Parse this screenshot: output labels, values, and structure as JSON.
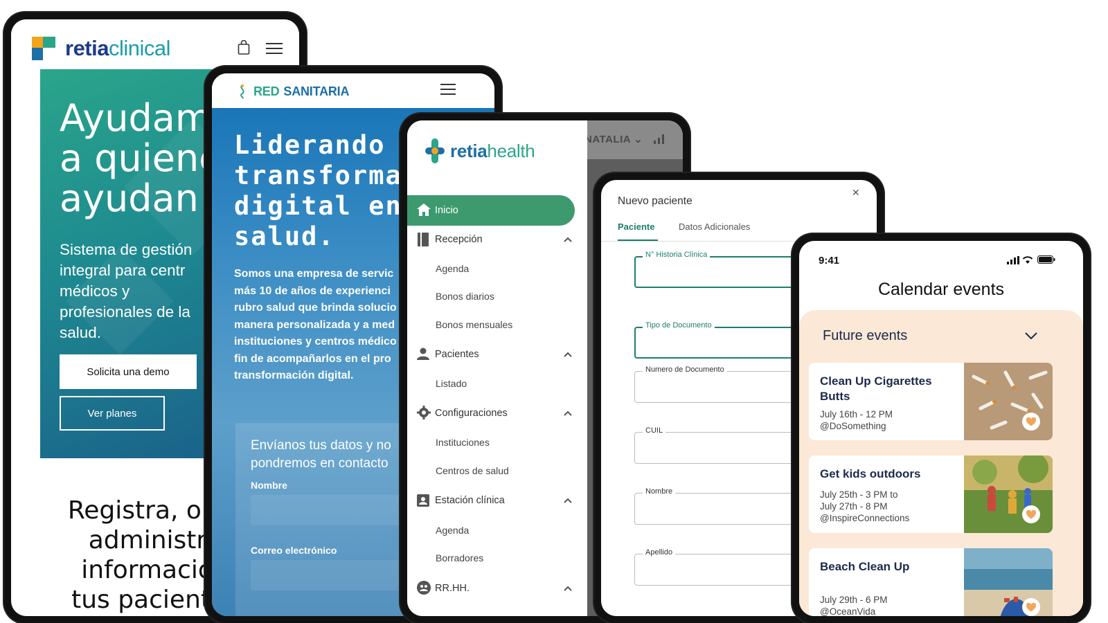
{
  "phone1": {
    "brand_bold": "retia",
    "brand_light": "clinical",
    "hero_title": "Ayudam\na quiene\nayudan",
    "hero_subtitle": "Sistema de gestión\nintegral para centr\nmédicos y\nprofesionales de la\nsalud.",
    "demo_button": "Solicita una demo",
    "plans_button": "Ver planes",
    "bottom_text": "Registra, orde\nadministra\ninformación\ntus pacientes",
    "colors": {
      "hero_start": "#2aa58a",
      "hero_end": "#1a5f8a",
      "brand_dark": "#1d3a8a",
      "brand_light": "#1d9bb0"
    }
  },
  "phone2": {
    "brand_red": "RED",
    "brand_sanitaria": "SANITARIA",
    "hero_title": "Liderando la\ntransformac\ndigital en\nsalud.",
    "hero_paragraph": "Somos una empresa de servic\nmás 10 de años de experienci\nrubro salud que brinda solucio\nmanera personalizada y a med\ninstituciones y centros médico\nfin de acompañarlos en el pro\ntransformación digital.",
    "form_title": "Envíanos tus datos y no\npondremos en contacto",
    "label_name": "Nombre",
    "label_email": "Correo electrónico"
  },
  "phone3": {
    "brand_a": "retia",
    "brand_b": "health",
    "user": "NATALIA",
    "menu": [
      {
        "label": "Inicio",
        "icon": "home-icon",
        "active": true
      },
      {
        "label": "Recepción",
        "icon": "book-icon"
      },
      {
        "label": "Pacientes",
        "icon": "person-icon"
      },
      {
        "label": "Configuraciones",
        "icon": "gear-icon"
      },
      {
        "label": "Estación clínica",
        "icon": "clipboard-icon"
      },
      {
        "label": "RR.HH.",
        "icon": "people-icon"
      }
    ],
    "submenu": {
      "recepcion": [
        "Agenda",
        "Bonos diarios",
        "Bonos mensuales"
      ],
      "pacientes": [
        "Listado"
      ],
      "configuraciones": [
        "Instituciones",
        "Centros de salud"
      ],
      "estacion": [
        "Agenda",
        "Borradores"
      ]
    },
    "colors": {
      "active": "#3d9a6e"
    }
  },
  "phone4": {
    "title": "Nuevo paciente",
    "tabs": [
      "Paciente",
      "Datos Adicionales"
    ],
    "fields": [
      "N° Historia Clínica",
      "Tipo de Documento",
      "Numero de Documento",
      "CUIL",
      "Nombre",
      "Apellido"
    ],
    "colors": {
      "accent": "#1b7f6a"
    }
  },
  "phone5": {
    "time": "9:41",
    "title": "Calendar events",
    "section": "Future events",
    "events": [
      {
        "title": "Clean Up Cigarettes\nButts",
        "meta": "July 16th - 12 PM\n@DoSomething",
        "image": "cigarette-butts-image"
      },
      {
        "title": "Get kids outdoors",
        "meta": "July 25th - 3 PM to\nJuly 27th - 8 PM\n@InspireConnections",
        "image": "kids-outdoors-image"
      },
      {
        "title": "Beach Clean Up",
        "meta": "July 29th - 6 PM\n@OceanVida",
        "image": "beach-cleanup-image"
      }
    ],
    "colors": {
      "panel": "#fbe8d6",
      "heart": "#f2a65a"
    }
  }
}
